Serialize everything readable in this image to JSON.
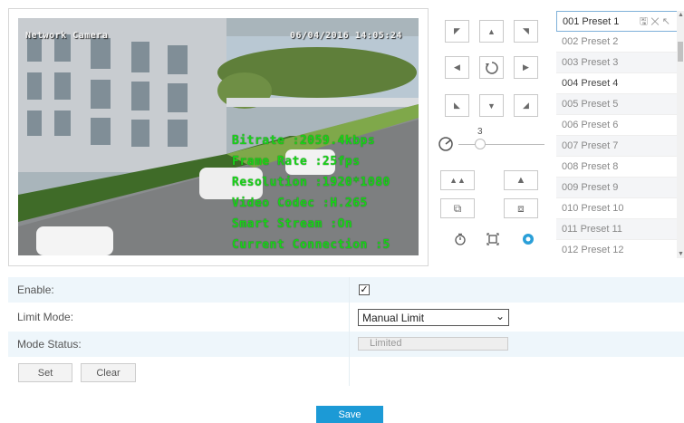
{
  "video": {
    "osd_top_left": "Network Camera",
    "osd_top_right": "06/04/2016 14:05:24",
    "overlay_lines": [
      "Bitrate :2059.4kbps",
      "Frame Rate :25fps",
      "Resolution :1920*1080",
      "Video Codec :H.265",
      "Smart Stream :On",
      "Current Connection :5"
    ]
  },
  "ptz": {
    "zoom_level": "3",
    "icons": [
      "arrow-up-left-icon",
      "arrow-up-icon",
      "arrow-up-right-icon",
      "arrow-left-icon",
      "refresh-icon",
      "arrow-right-icon",
      "arrow-down-left-icon",
      "arrow-down-icon",
      "arrow-down-right-icon",
      "speed-icon",
      "zoom-out-icon",
      "zoom-in-icon",
      "focus-near-icon",
      "focus-far-icon",
      "timer-icon",
      "fullscreen-icon",
      "settings-icon"
    ]
  },
  "presets": {
    "items": [
      {
        "label": "001 Preset 1"
      },
      {
        "label": "002 Preset 2"
      },
      {
        "label": "003 Preset 3"
      },
      {
        "label": "004 Preset 4"
      },
      {
        "label": "005 Preset 5"
      },
      {
        "label": "006 Preset 6"
      },
      {
        "label": "007 Preset 7"
      },
      {
        "label": "008 Preset 8"
      },
      {
        "label": "009 Preset 9"
      },
      {
        "label": "010 Preset 10"
      },
      {
        "label": "011 Preset 11"
      },
      {
        "label": "012 Preset 12"
      }
    ]
  },
  "form": {
    "enable_label": "Enable:",
    "enable_checked": true,
    "limit_mode_label": "Limit Mode:",
    "limit_mode_value": "Manual Limit",
    "mode_status_label": "Mode Status:",
    "mode_status_value": "Limited",
    "set_label": "Set",
    "clear_label": "Clear"
  },
  "save_label": "Save",
  "colors": {
    "accent": "#1c9ad6",
    "osd_green": "#19d219",
    "row_blue": "#eef6fb"
  }
}
